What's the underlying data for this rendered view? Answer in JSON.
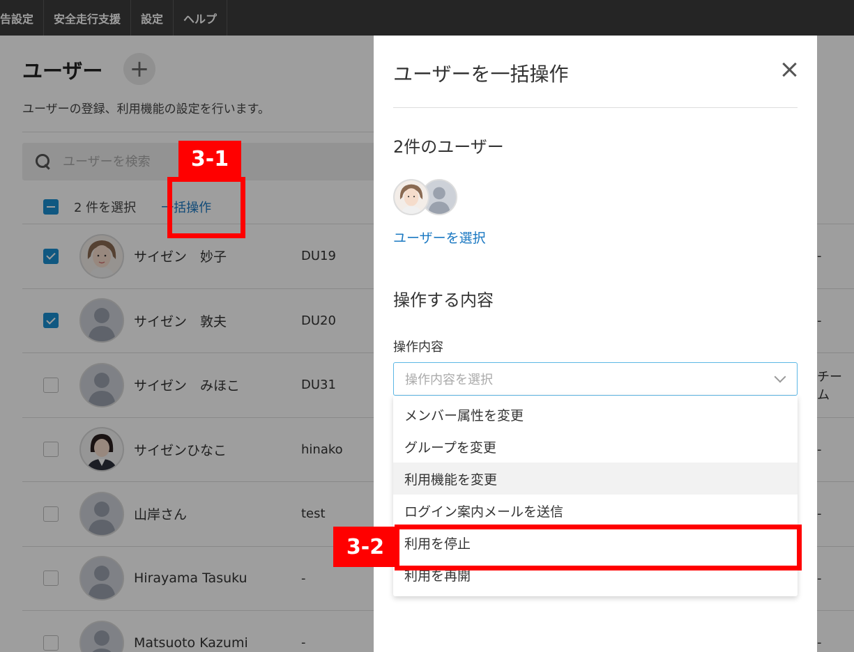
{
  "topnav": {
    "items": [
      "報告設定",
      "安全走行支援",
      "設定",
      "ヘルプ"
    ]
  },
  "page": {
    "title": "ユーザー",
    "add_label": "+",
    "description": "ユーザーの登録、利用機能の設定を行います。",
    "search_placeholder": "ユーザーを検索",
    "bulk_count": "2 件を選択",
    "bulk_link": "一括操作"
  },
  "users": [
    {
      "name": "サイゼン　妙子",
      "id": "DU19",
      "checked": true,
      "avatar": "photo-woman",
      "extra": "-"
    },
    {
      "name": "サイゼン　敦夫",
      "id": "DU20",
      "checked": true,
      "avatar": "placeholder",
      "extra": "-"
    },
    {
      "name": "サイゼン　みほこ",
      "id": "DU31",
      "checked": false,
      "avatar": "placeholder",
      "extra": "チーム"
    },
    {
      "name": "サイゼンひなこ",
      "id": "hinako",
      "checked": false,
      "avatar": "photo-woman-suit",
      "extra": "-"
    },
    {
      "name": "山岸さん",
      "id": "test",
      "checked": false,
      "avatar": "placeholder",
      "extra": "-"
    },
    {
      "name": "Hirayama Tasuku",
      "id": "-",
      "checked": false,
      "avatar": "placeholder",
      "extra": "-"
    },
    {
      "name": "Matsuoto Kazumi",
      "id": "-",
      "checked": false,
      "avatar": "placeholder",
      "extra": "-"
    }
  ],
  "modal": {
    "title": "ユーザーを一括操作",
    "selected_count": "2件のユーザー",
    "select_users_link": "ユーザーを選択",
    "operation_heading": "操作する内容",
    "operation_label": "操作内容",
    "operation_placeholder": "操作内容を選択",
    "options": [
      "メンバー属性を変更",
      "グループを変更",
      "利用機能を変更",
      "ログイン案内メールを送信",
      "利用を停止",
      "利用を再開"
    ]
  },
  "callouts": {
    "first": "3-1",
    "second": "3-2"
  },
  "colors": {
    "accent": "#1a78c2",
    "checkbox": "#1a8fd0",
    "callout": "#ff0000",
    "nav_bg": "#3c3c3c"
  }
}
